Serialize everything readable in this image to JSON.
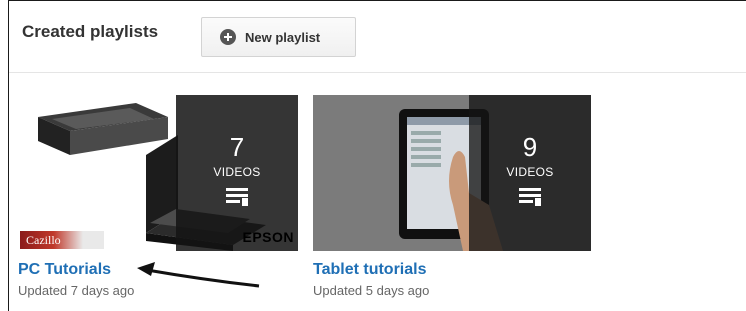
{
  "header": {
    "title": "Created playlists",
    "new_playlist_label": "New playlist"
  },
  "playlists": [
    {
      "title": "PC Tutorials",
      "updated": "Updated 7 days ago",
      "count": "7",
      "videos_label": "VIDEOS",
      "brand_label": "Cazillo",
      "product_mark": "EPSON"
    },
    {
      "title": "Tablet tutorials",
      "updated": "Updated 5 days ago",
      "count": "9",
      "videos_label": "VIDEOS"
    }
  ],
  "icons": {
    "new_playlist": "plus-circle-icon",
    "playlist": "playlist-icon",
    "annotation": "arrow-icon"
  },
  "colors": {
    "link": "#1f6fb5",
    "overlay": "#141414",
    "button_border": "#d3d3d3"
  }
}
